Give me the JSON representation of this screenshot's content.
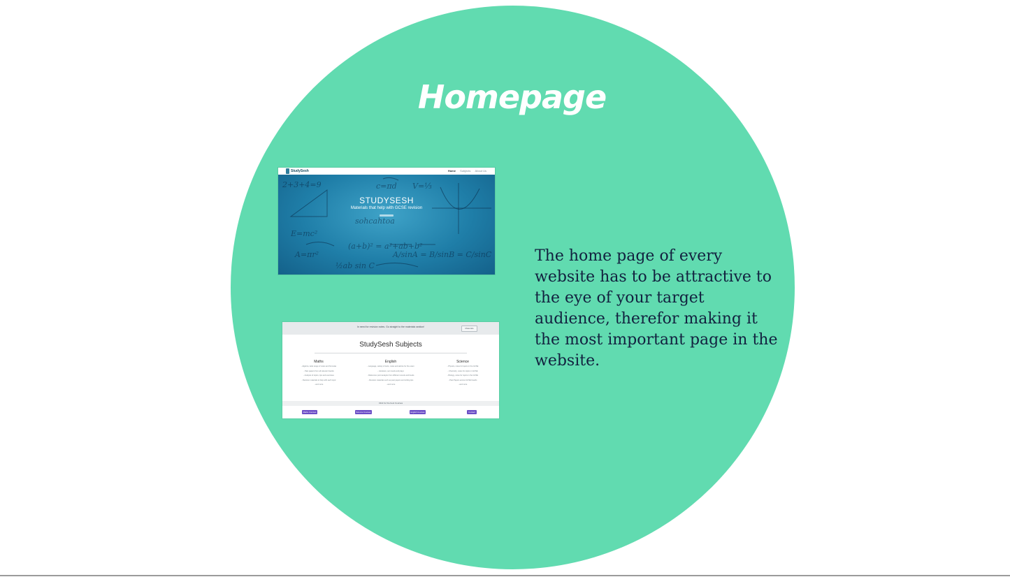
{
  "slide": {
    "title": "Homepage",
    "description": "The home page of every website has to be attractive to the eye of your target audience, therefor making it the most important page in the website."
  },
  "colors": {
    "circle": "#61dbb0",
    "title_text": "#ffffff",
    "body_text": "#12213f",
    "accent_button": "#6b4ec7"
  },
  "screenshot_hero": {
    "logo_text": "StudySesh",
    "nav": [
      "Home",
      "Subjects",
      "About Us"
    ],
    "hero_title": "STUDYSESH",
    "hero_subtitle": "Materials that help with GCSE revision"
  },
  "screenshot_subjects": {
    "banner_text": "In need for revision notes. Go straight to the materials section!",
    "banner_button": "Materials",
    "heading": "StudySesh Subjects",
    "columns": [
      {
        "title": "Maths",
        "lines": [
          "- Algebra, wide range of notes and formulas",
          "- Past papers from all relevant boards",
          "- Analysis of topics, tips and exercises",
          "- Revision materials to help with each topic",
          "- and more"
        ]
      },
      {
        "title": "English",
        "lines": [
          "- Language, variety of texts, notes and advice for the exam",
          "- Literature, set novels and plays",
          "- Reference point analysis from different novels and books",
          "- Revision materials such as past papers and writing tips",
          "- and more"
        ]
      },
      {
        "title": "Science",
        "lines": [
          "- Physics, notes for topics in the GCSE",
          "- Chemistry, notes for topics in GCSE",
          "- Biology, notes for topics in the GCSE",
          "- Past Papers across GCSE boards",
          "- and more"
        ]
      }
    ],
    "footer_text": "Click for the best Courses",
    "buttons": [
      "Maths Courses",
      "Science Courses",
      "English Courses",
      "Contact"
    ]
  }
}
